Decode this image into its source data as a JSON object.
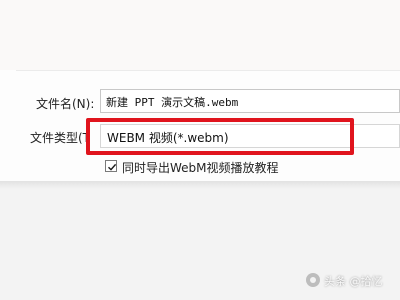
{
  "dialog": {
    "file_name_label": "文件名(N):",
    "file_name_value": "新建 PPT 演示文稿.webm",
    "file_type_label": "文件类型(T",
    "file_type_value": "WEBM 视频(*.webm)",
    "export_tutorial_label": "同时导出WebM视频播放教程",
    "export_tutorial_checked": true
  },
  "annotation": {
    "highlight_color": "#e0141d"
  },
  "watermark": {
    "text": "头条 @拾忆"
  },
  "icons": {
    "checkbox_check": "check-icon",
    "watermark_logo": "watermark-logo-icon"
  }
}
